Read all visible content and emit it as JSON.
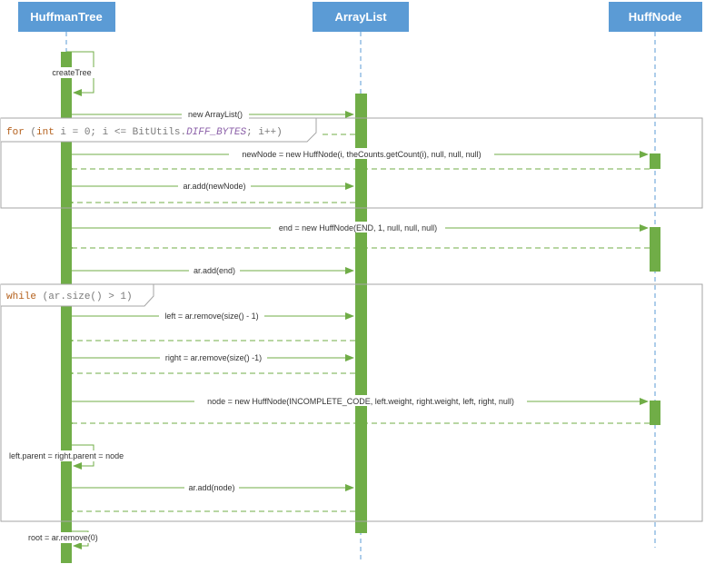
{
  "lifelines": {
    "huffman_tree": "HuffmanTree",
    "array_list": "ArrayList",
    "huff_node": "HuffNode"
  },
  "messages": {
    "create_tree": "createTree",
    "new_arraylist": "new ArrayList()",
    "new_node": "newNode = new HuffNode(i, theCounts.getCount(i), null, null, null)",
    "add_new_node": "ar.add(newNode)",
    "end_node": "end = new HuffNode(END, 1, null, null, null)",
    "add_end": "ar.add(end)",
    "left_remove": "left = ar.remove(size() - 1)",
    "right_remove": "right = ar.remove(size() -1)",
    "node_create": "node = new HuffNode(INCOMPLETE_CODE, left.weight, right.weight, left, right, null)",
    "set_parents": "left.parent = right.parent = node",
    "add_node": "ar.add(node)",
    "root_remove": "root = ar.remove(0)"
  },
  "for_loop": {
    "kw_for": "for",
    "open": " (",
    "kw_int": "int",
    "mid": " i = 0; i <= BitUtils.",
    "const": "DIFF_BYTES",
    "end": "; i++)"
  },
  "while_loop": {
    "kw_while": "while",
    "cond": " (ar.size() > 1)"
  },
  "colors": {
    "header_fill": "#5b9bd5",
    "activation_fill": "#70ad47",
    "lifeline": "#5b9bd5",
    "message": "#70ad47",
    "keyword": "#b4601c",
    "frame_border": "#a6a6a6"
  }
}
